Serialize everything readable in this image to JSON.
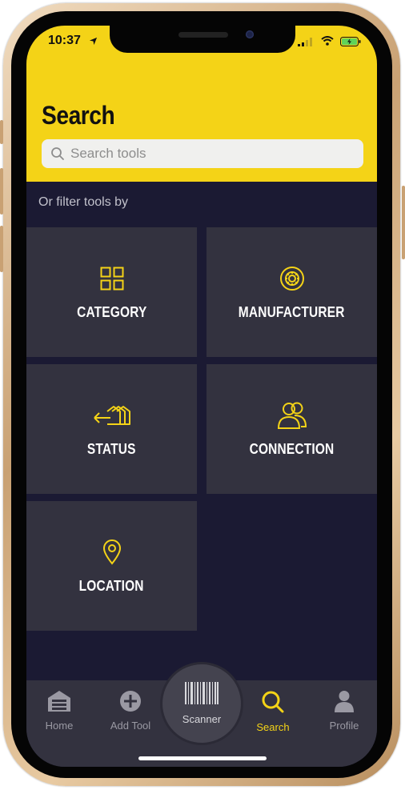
{
  "status_bar": {
    "time": "10:37"
  },
  "header": {
    "title": "Search",
    "search_placeholder": "Search tools"
  },
  "filter_label": "Or filter tools by",
  "tiles": [
    {
      "label": "CATEGORY",
      "icon": "grid-icon"
    },
    {
      "label": "MANUFACTURER",
      "icon": "gear-icon"
    },
    {
      "label": "STATUS",
      "icon": "status-arrow-icon"
    },
    {
      "label": "CONNECTION",
      "icon": "people-icon"
    },
    {
      "label": "LOCATION",
      "icon": "map-pin-icon"
    }
  ],
  "tabbar": {
    "home": "Home",
    "add_tool": "Add Tool",
    "scanner": "Scanner",
    "search": "Search",
    "profile": "Profile"
  },
  "colors": {
    "accent": "#f4d317",
    "background": "#1b1a33",
    "tile": "#33323f",
    "tab_inactive": "#9a99a3"
  }
}
